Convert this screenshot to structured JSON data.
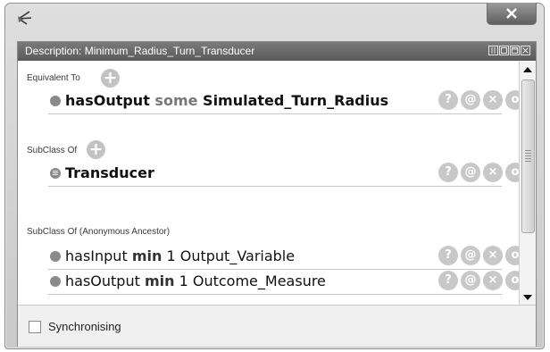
{
  "panel": {
    "title": "Description: Minimum_Radius_Turn_Transducer"
  },
  "sections": {
    "equivalent_to": {
      "label": "Equivalent To",
      "rows": [
        {
          "prop": "hasOutput",
          "keyword": "some",
          "filler": "Simulated_Turn_Radius"
        }
      ]
    },
    "subclass_of": {
      "label": "SubClass Of",
      "rows": [
        {
          "class": "Transducer"
        }
      ]
    },
    "subclass_of_anonymous": {
      "label": "SubClass Of (Anonymous Ancestor)",
      "rows": [
        {
          "prop": "hasInput",
          "keyword": "min",
          "cardinality": "1",
          "filler": "Output_Variable"
        },
        {
          "prop": "hasOutput",
          "keyword": "min",
          "cardinality": "1",
          "filler": "Outcome_Measure"
        }
      ]
    }
  },
  "row_actions": {
    "help": "?",
    "annotate": "@",
    "delete": "×",
    "edit": "o"
  },
  "add_glyph": "+",
  "footer": {
    "sync_label": "Synchronising",
    "sync_checked": false
  },
  "colors": {
    "header_bg": "#6a6a6a",
    "action_bg": "#c8c8c8",
    "window_bg": "#d4d4d4"
  },
  "icons": {
    "app": "protege-app-icon",
    "close": "close-icon",
    "scroll_up": "arrow-up-icon",
    "scroll_down": "arrow-down-icon"
  }
}
